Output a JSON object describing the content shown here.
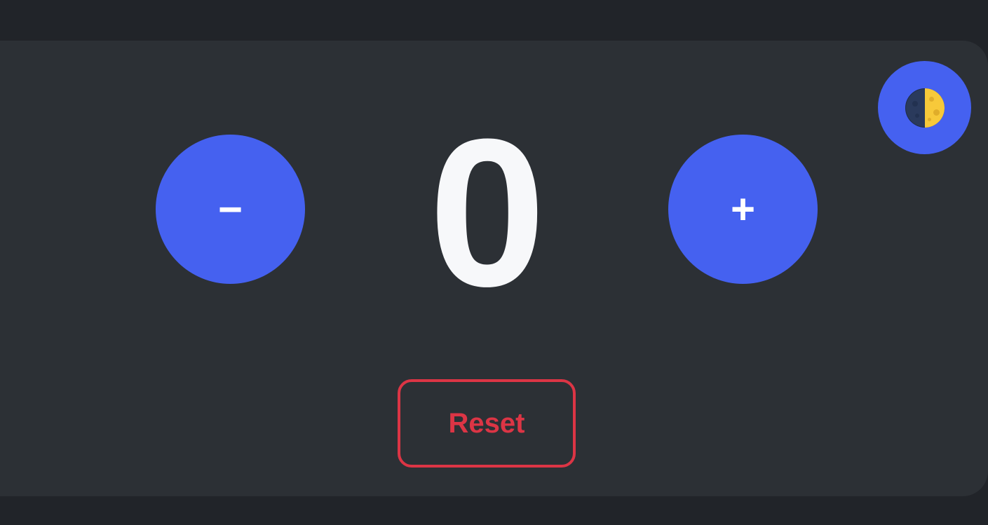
{
  "theme_toggle": {
    "icon": "first-quarter-moon-icon",
    "background": "#4561f0"
  },
  "counter": {
    "value": "0",
    "decrement_label": "−",
    "increment_label": "+",
    "button_color": "#4561f0"
  },
  "reset": {
    "label": "Reset",
    "color": "#dc3545"
  }
}
